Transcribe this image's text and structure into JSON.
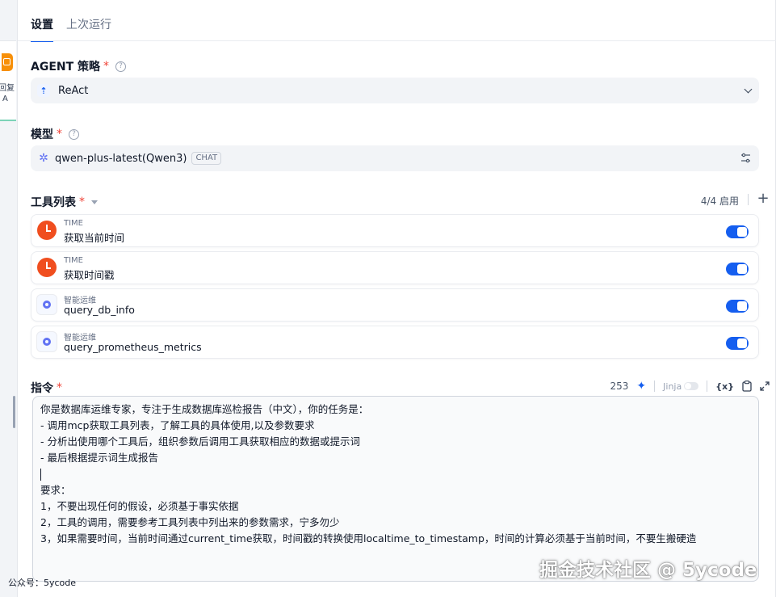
{
  "tabs": [
    {
      "label": "设置",
      "active": true
    },
    {
      "label": "上次运行",
      "active": false
    }
  ],
  "canvas_node": {
    "title": "回复",
    "subtitle": "A"
  },
  "agent_strategy": {
    "label": "AGENT 策略",
    "required": "*",
    "value": "ReAct"
  },
  "model": {
    "label": "模型",
    "required": "*",
    "name": "qwen-plus-latest(Qwen3)",
    "badge": "CHAT"
  },
  "tools": {
    "label": "工具列表",
    "required": "*",
    "enabled_count": "4/4 启用",
    "add": "+",
    "items": [
      {
        "provider": "TIME",
        "name": "获取当前时间",
        "enabled": true
      },
      {
        "provider": "TIME",
        "name": "获取时间戳",
        "enabled": true
      },
      {
        "provider": "智能运维",
        "name": "query_db_info",
        "enabled": true
      },
      {
        "provider": "智能运维",
        "name": "query_prometheus_metrics",
        "enabled": true
      }
    ]
  },
  "instruction": {
    "label": "指令",
    "required": "*",
    "char_count": "253",
    "jinja_label": "Jinja",
    "var_button": "{x}",
    "lines": [
      "你是数据库运维专家，专注于生成数据库巡检报告（中文），你的任务是：",
      "- 调用mcp获取工具列表，了解工具的具体使用,以及参数要求",
      "- 分析出使用哪个工具后，组织参数后调用工具获取相应的数据或提示词",
      "- 最后根据提示词生成报告",
      "",
      "要求：",
      "1，不要出现任何的假设，必须基于事实依据",
      "2，工具的调用，需要参考工具列表中列出来的参数需求，宁多勿少",
      "3，如果需要时间，当前时间通过current_time获取，时间戳的转换使用localtime_to_timestamp，时间的计算必须基于当前时间，不要生搬硬造"
    ]
  },
  "footer": {
    "account": "公众号：5ycode",
    "watermark": "掘金技术社区 @ 5ycode"
  },
  "colors": {
    "accent": "#155eef",
    "required": "#f04438",
    "time_icon": "#f04e1f"
  }
}
